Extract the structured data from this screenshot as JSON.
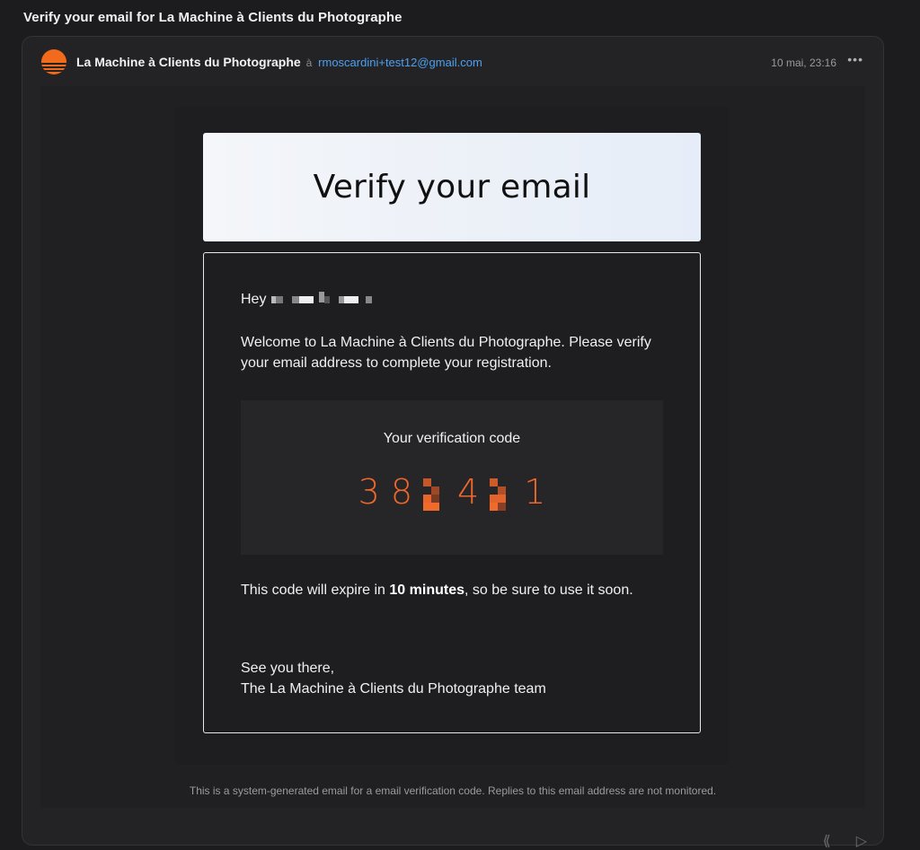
{
  "subject": "Verify your email for La Machine à Clients du Photographe",
  "sender": {
    "name": "La Machine à Clients du Photographe",
    "to_prefix": "à",
    "to_email": "rmoscardini+test12@gmail.com",
    "date": "10 mai, 23:16",
    "more_icon": "more-horizontal-icon"
  },
  "email": {
    "hero_title": "Verify your email",
    "greeting": "Hey",
    "welcome": "Welcome to La Machine à Clients du Photographe. Please verify your email address to complete your registration.",
    "code_label": "Your verification code",
    "code_digits": [
      "3",
      "8",
      "",
      "4",
      "",
      "1"
    ],
    "expire_before": "This code will expire in ",
    "expire_bold": "10 minutes",
    "expire_after": ", so be sure to use it soon.",
    "signoff_line1": "See you there,",
    "signoff_line2": "The La Machine à Clients du Photographe team",
    "footer": "This is a system-generated email for a email verification code. Replies to this email address are not monitored."
  },
  "colors": {
    "accent": "#f0672b",
    "link": "#4da0f0",
    "background": "#1c1c1f"
  }
}
